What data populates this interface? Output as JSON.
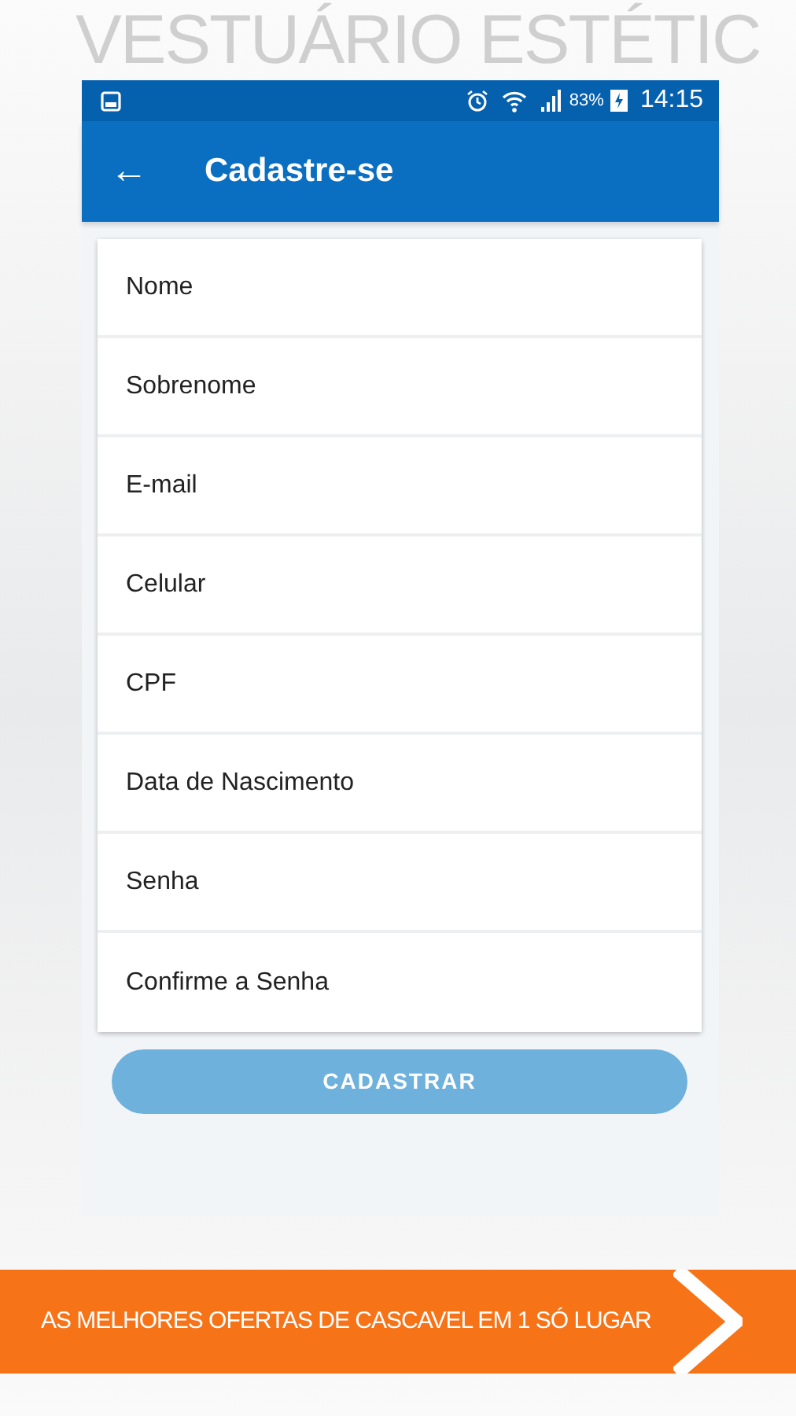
{
  "backdrop_text": "VESTUÁRIO ESTÉTIC",
  "status_bar": {
    "battery": "83%",
    "time": "14:15"
  },
  "app_bar": {
    "back": "←",
    "title": "Cadastre-se"
  },
  "form": {
    "fields": [
      {
        "placeholder": "Nome"
      },
      {
        "placeholder": "Sobrenome"
      },
      {
        "placeholder": "E-mail"
      },
      {
        "placeholder": "Celular"
      },
      {
        "placeholder": "CPF"
      },
      {
        "placeholder": "Data de Nascimento"
      },
      {
        "placeholder": "Senha"
      },
      {
        "placeholder": "Confirme a Senha"
      }
    ],
    "submit": {
      "label": "CADASTRAR",
      "disabled": true
    }
  },
  "banner": {
    "text": "AS MELHORES OFERTAS DE CASCAVEL EM 1 SÓ LUGAR"
  }
}
